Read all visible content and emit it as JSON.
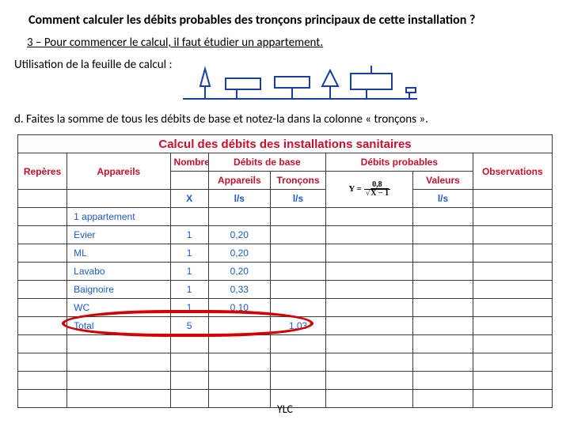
{
  "title": "Comment calculer les débits probables des tronçons principaux de cette installation ?",
  "step": "3 – Pour commencer le calcul, il faut étudier un appartement.",
  "subline": "Utilisation de la feuille de calcul :",
  "instr": "d. Faites la somme de tous les débits de base et notez-la dans la colonne « tronçons ».",
  "table": {
    "caption": "Calcul des débits des installations sanitaires",
    "headers": {
      "reperes": "Repères",
      "appareils": "Appareils",
      "nombre": "Nombre",
      "debits_base": "Débits de base",
      "debits_base_app": "Appareils",
      "debits_base_tr": "Tronçons",
      "debits_prob": "Débits probables",
      "valeurs": "Valeurs",
      "observations": "Observations"
    },
    "units": {
      "x": "X",
      "ls1": "l/s",
      "ls2": "l/s",
      "ls3": "l/s"
    },
    "formula": {
      "lhs": "Y",
      "num": "0,8",
      "den_pre": "√",
      "den_body": "X − 1"
    },
    "rows": [
      {
        "rep": "",
        "app": "1 appartement",
        "x": "",
        "dapp": "",
        "dtr": "",
        "y": "",
        "val": "",
        "obs": ""
      },
      {
        "rep": "",
        "app": "Evier",
        "x": "1",
        "dapp": "0,20",
        "dtr": "",
        "y": "",
        "val": "",
        "obs": ""
      },
      {
        "rep": "",
        "app": "ML",
        "x": "1",
        "dapp": "0,20",
        "dtr": "",
        "y": "",
        "val": "",
        "obs": ""
      },
      {
        "rep": "",
        "app": "Lavabo",
        "x": "1",
        "dapp": "0,20",
        "dtr": "",
        "y": "",
        "val": "",
        "obs": ""
      },
      {
        "rep": "",
        "app": "Baignoire",
        "x": "1",
        "dapp": "0,33",
        "dtr": "",
        "y": "",
        "val": "",
        "obs": ""
      },
      {
        "rep": "",
        "app": "WC",
        "x": "1",
        "dapp": "0,10",
        "dtr": "",
        "y": "",
        "val": "",
        "obs": ""
      },
      {
        "rep": "",
        "app": "Total",
        "x": "5",
        "dapp": "",
        "dtr": "1,03",
        "y": "",
        "val": "",
        "obs": ""
      },
      {
        "rep": "",
        "app": "",
        "x": "",
        "dapp": "",
        "dtr": "",
        "y": "",
        "val": "",
        "obs": ""
      },
      {
        "rep": "",
        "app": "",
        "x": "",
        "dapp": "",
        "dtr": "",
        "y": "",
        "val": "",
        "obs": ""
      },
      {
        "rep": "",
        "app": "",
        "x": "",
        "dapp": "",
        "dtr": "",
        "y": "",
        "val": "",
        "obs": ""
      },
      {
        "rep": "",
        "app": "",
        "x": "",
        "dapp": "",
        "dtr": "",
        "y": "",
        "val": "",
        "obs": ""
      }
    ]
  },
  "footer": "YLC",
  "chart_data": {
    "type": "table",
    "title": "Calcul des débits des installations sanitaires",
    "columns": [
      "Repères",
      "Appareils",
      "Nombre X",
      "Débits de base Appareils l/s",
      "Débits de base Tronçons l/s",
      "Y = 0,8 / √(X−1)",
      "Valeurs l/s",
      "Observations"
    ],
    "rows": [
      [
        "",
        "1 appartement",
        "",
        "",
        "",
        "",
        "",
        ""
      ],
      [
        "",
        "Evier",
        "1",
        "0,20",
        "",
        "",
        "",
        ""
      ],
      [
        "",
        "ML",
        "1",
        "0,20",
        "",
        "",
        "",
        ""
      ],
      [
        "",
        "Lavabo",
        "1",
        "0,20",
        "",
        "",
        "",
        ""
      ],
      [
        "",
        "Baignoire",
        "1",
        "0,33",
        "",
        "",
        "",
        ""
      ],
      [
        "",
        "WC",
        "1",
        "0,10",
        "",
        "",
        "",
        ""
      ],
      [
        "",
        "Total",
        "5",
        "",
        "1,03",
        "",
        "",
        ""
      ]
    ]
  }
}
